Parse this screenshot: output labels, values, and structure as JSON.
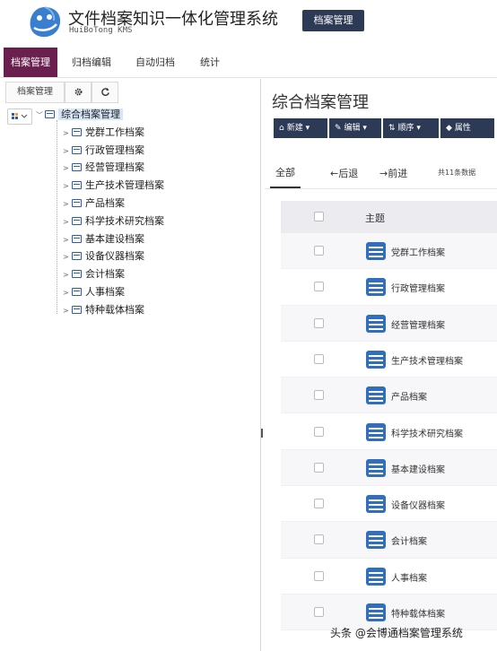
{
  "app": {
    "title": "文件档案知识一体化管理系统",
    "subtitle": "HuiBoTong KMS",
    "module_badge": "档案管理"
  },
  "nav": {
    "items": [
      {
        "label": "档案管理",
        "active": true
      },
      {
        "label": "归档编辑",
        "active": false
      },
      {
        "label": "自动归档",
        "active": false
      },
      {
        "label": "统计",
        "active": false
      }
    ]
  },
  "sidebar": {
    "tab_label": "档案管理",
    "gear_icon": "gear-icon",
    "refresh_icon": "refresh-icon",
    "tree": {
      "root": "综合档案管理",
      "children": [
        "党群工作档案",
        "行政管理档案",
        "经营管理档案",
        "生产技术管理档案",
        "产品档案",
        "科学技术研究档案",
        "基本建设档案",
        "设备仪器档案",
        "会计档案",
        "人事档案",
        "特种载体档案"
      ]
    }
  },
  "main": {
    "title": "综合档案管理",
    "toolbar": [
      {
        "label": "新建",
        "icon": "new-icon"
      },
      {
        "label": "编辑",
        "icon": "edit-icon"
      },
      {
        "label": "顺序",
        "icon": "sort-icon"
      },
      {
        "label": "属性",
        "icon": "tag-icon"
      }
    ],
    "tab_all": "全部",
    "back": "←后退",
    "forward": "→前进",
    "count": "共11条数据",
    "table": {
      "header": "主题",
      "rows": [
        "党群工作档案",
        "行政管理档案",
        "经营管理档案",
        "生产技术管理档案",
        "产品档案",
        "科学技术研究档案",
        "基本建设档案",
        "设备仪器档案",
        "会计档案",
        "人事档案",
        "特种载体档案"
      ]
    }
  },
  "watermark": "头条 @会博通档案管理系统",
  "colors": {
    "nav_active": "#6a1f4e",
    "toolbar": "#2d3a55",
    "icon_blue": "#2c5ea8"
  }
}
